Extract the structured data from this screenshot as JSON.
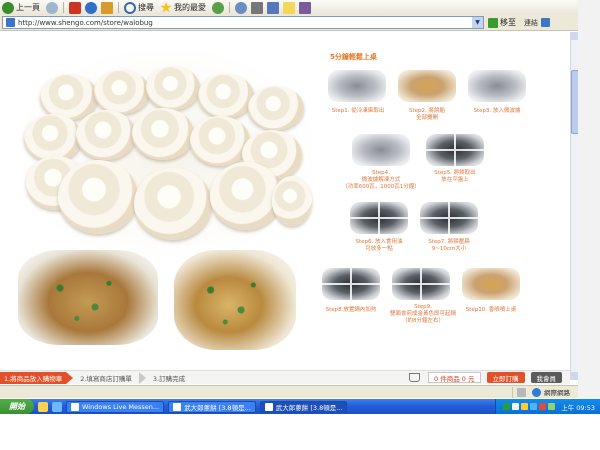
{
  "toolbar": {
    "back_label": "上一頁",
    "search_label": "搜尋",
    "favorites_label": "我的最愛"
  },
  "address": {
    "url": "http://www.shengo.com/store/walobug",
    "go_label": "移至",
    "links_label": "連結"
  },
  "steps": {
    "title": "5分鐘輕鬆上桌",
    "items": [
      {
        "label": "Step1. 從冷凍庫取出"
      },
      {
        "label": "Step2. 將餅餡\n全部攤開"
      },
      {
        "label": "Step3. 放入微波爐"
      },
      {
        "label": "Step4.\n微波爐解凍方式\n（功率600瓦，1000瓦1分鐘）"
      },
      {
        "label": "Step5. 將餅取出\n放在平盤上"
      },
      {
        "label": "Step6. 放入食用油\n可放多一點"
      },
      {
        "label": "Step7. 將餅壓扁\n9~10cm大小"
      },
      {
        "label": "Step8.放置鍋內加熱"
      },
      {
        "label": "Step9.\n雙面會煎成金黃色即可起鍋\n（約8分鐘左右）"
      },
      {
        "label": "Step10. 香噴噴上桌"
      }
    ]
  },
  "order_bar": {
    "step1": "1.將商品放入購物車",
    "step2": "2.填寫商店訂購單",
    "step3": "3.訂購完成",
    "cart_text": "0 件商品  0 元",
    "checkout_label": "立即訂購",
    "member_label": "我會員"
  },
  "status_bar": {
    "zone_label": "網際網路"
  },
  "taskbar": {
    "start_label": "開始",
    "tasks": [
      {
        "label": "Windows Live Messen..."
      },
      {
        "label": "武大郎蔥餅 [3.8頓是..."
      },
      {
        "label": "武大郎蔥餅 [3.8頓是..."
      }
    ],
    "clock": "上午 09:53"
  },
  "colors": {
    "accent_orange": "#e07a2a",
    "order_red": "#e2502a",
    "taskbar_blue": "#245edb"
  }
}
